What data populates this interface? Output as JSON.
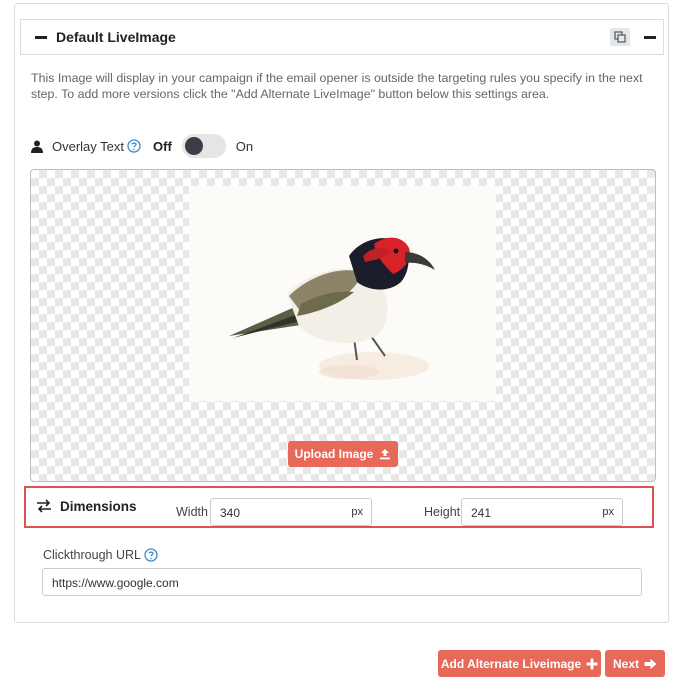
{
  "header": {
    "title": "Default LiveImage",
    "copy_icon": "copy-icon",
    "collapse_icon": "minus-icon"
  },
  "description": "This Image will display in your campaign if the email opener is outside the targeting rules you specify in the next step. To add more versions click the \"Add Alternate LiveImage\" button below this settings area.",
  "overlay": {
    "label": "Overlay Text",
    "off_label": "Off",
    "on_label": "On",
    "enabled": false
  },
  "image": {
    "upload_label": "Upload Image",
    "upload_icon": "upload-icon"
  },
  "dimensions": {
    "title": "Dimensions",
    "width_label": "Width",
    "width_value": "340",
    "width_unit": "px",
    "height_label": "Height",
    "height_value": "241",
    "height_unit": "px"
  },
  "clickthrough": {
    "label": "Clickthrough URL",
    "value": "https://www.google.com"
  },
  "actions": {
    "add_alternate_label": "Add Alternate Liveimage",
    "next_label": "Next"
  },
  "colors": {
    "accent": "#e8685a",
    "highlight_border": "#d9534f",
    "help_icon": "#3a8fc7"
  }
}
